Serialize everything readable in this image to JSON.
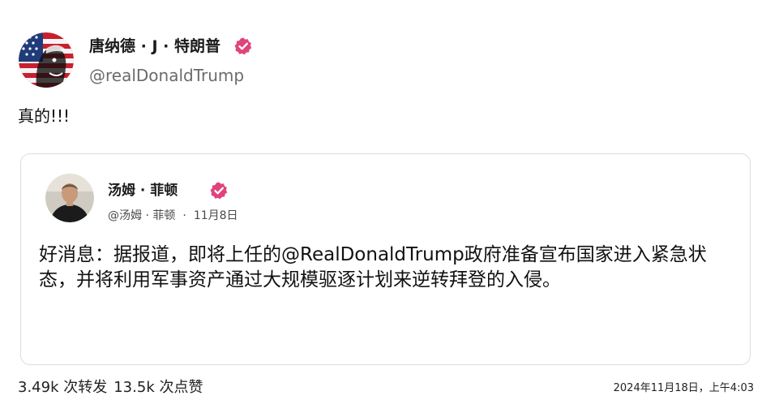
{
  "author": {
    "name": "唐纳德 · J · 特朗普",
    "handle": "@realDonaldTrump",
    "verified_icon": "verified-badge-icon",
    "badge_color": "#e0447c"
  },
  "post": {
    "text": "真的!!!"
  },
  "quote": {
    "author_name": "汤姆 · 菲顿",
    "author_handle": "@汤姆 · 菲顿",
    "separator": "·",
    "date": "11月8日",
    "text": "好消息：据报道，即将上任的@RealDonaldTrump政府准备宣布国家进入紧急状态，并将利用军事资产通过大规模驱逐计划来逆转拜登的入侵。",
    "verified_icon": "verified-badge-icon"
  },
  "footer": {
    "reposts": "3.49k 次转发",
    "likes": "13.5k 次点赞",
    "timestamp": "2024年11月18日，上午4:03"
  }
}
